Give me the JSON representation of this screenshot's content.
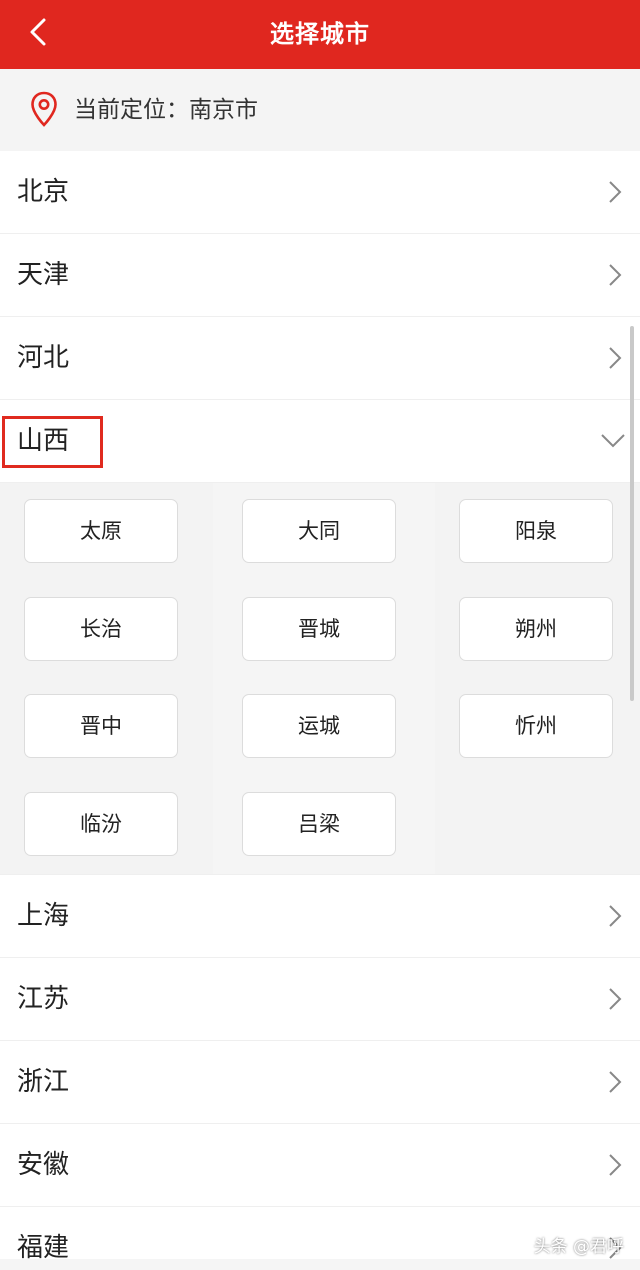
{
  "header": {
    "title": "选择城市",
    "back_icon": "chevron-left-icon",
    "background": "#e0271f"
  },
  "location": {
    "icon": "location-pin-icon",
    "text": "当前定位：南京市",
    "icon_color": "#e0271f"
  },
  "provinces_before": [
    {
      "label": "北京"
    },
    {
      "label": "天津"
    },
    {
      "label": "河北"
    }
  ],
  "expanded": {
    "label": "山西",
    "highlight_color": "#e02a1f",
    "cities": [
      "太原",
      "大同",
      "阳泉",
      "长治",
      "晋城",
      "朔州",
      "晋中",
      "运城",
      "忻州",
      "临汾",
      "吕梁"
    ]
  },
  "provinces_after": [
    {
      "label": "上海"
    },
    {
      "label": "江苏"
    },
    {
      "label": "浙江"
    },
    {
      "label": "安徽"
    },
    {
      "label": "福建"
    }
  ],
  "watermark": "头条 @君呼"
}
